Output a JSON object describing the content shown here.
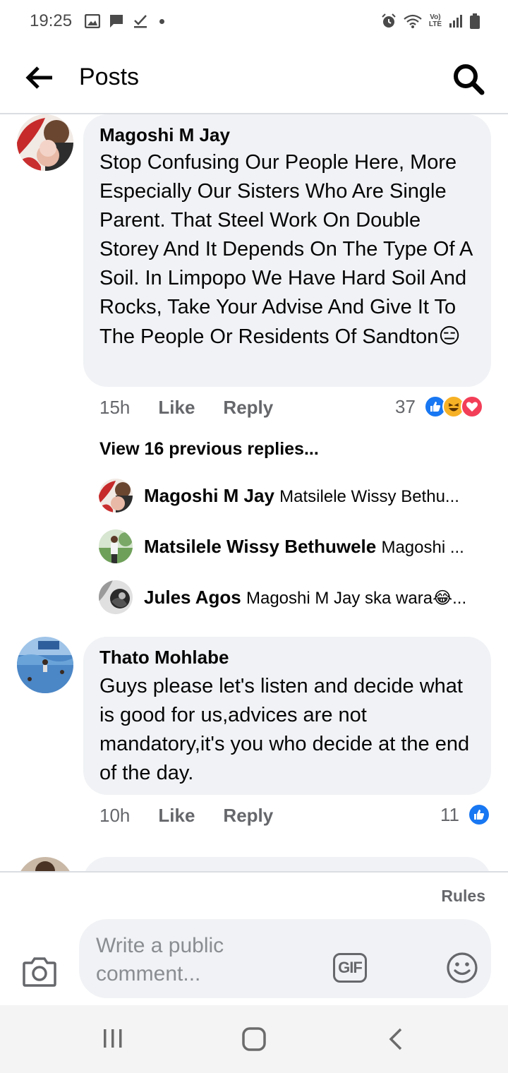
{
  "status_bar": {
    "time": "19:25",
    "left_icons": [
      "gallery-icon",
      "chat-icon",
      "check-icon",
      "dot-icon"
    ],
    "right_icons": [
      "alarm-icon",
      "wifi-icon",
      "volte-icon",
      "signal-icon",
      "battery-icon"
    ],
    "volte_top": "Vo)",
    "volte_bottom": "LTE"
  },
  "header": {
    "back_icon": "arrow-left-icon",
    "title": "Posts",
    "search_icon": "search-icon"
  },
  "comments": [
    {
      "author": "Magoshi M Jay",
      "text": "Stop Confusing Our People Here, More Especially Our Sisters Who Are Single Parent. That Steel Work On Double Storey And It Depends On The Type Of A Soil. In Limpopo We Have Hard Soil And Rocks, Take Your Advise And Give It To The People Or Residents Of Sandton",
      "emoji": "😑",
      "time": "15h",
      "like_label": "Like",
      "reply_label": "Reply",
      "reaction_count": "37",
      "reactions": [
        "like",
        "haha",
        "love"
      ],
      "view_replies": "View 16 previous replies...",
      "replies": [
        {
          "name": "Magoshi M Jay",
          "snippet": "Matsilele Wissy Bethu..."
        },
        {
          "name": "Matsilele Wissy Bethuwele",
          "snippet": "Magoshi ..."
        },
        {
          "name": "Jules Agos",
          "snippet": "Magoshi M Jay ska wara😂..."
        }
      ]
    },
    {
      "author": "Thato Mohlabe",
      "text": "Guys please let's listen and decide what is good for us,advices are not mandatory,it's  you who decide at the end of the day.",
      "time": "10h",
      "like_label": "Like",
      "reply_label": "Reply",
      "reaction_count": "11",
      "reactions": [
        "like"
      ]
    }
  ],
  "composer": {
    "rules_label": "Rules",
    "placeholder": "Write a public comment...",
    "gif_label": "GIF",
    "camera_icon": "camera-icon",
    "emoji_icon": "smiley-icon"
  },
  "nav_bar": {
    "icons": [
      "recent-apps-icon",
      "home-icon",
      "back-icon"
    ]
  },
  "colors": {
    "bubble": "#f0f2f5",
    "meta_text": "#65676b",
    "like_blue": "#1877f2",
    "love_red": "#f33e58",
    "haha_yellow": "#f7b125"
  }
}
